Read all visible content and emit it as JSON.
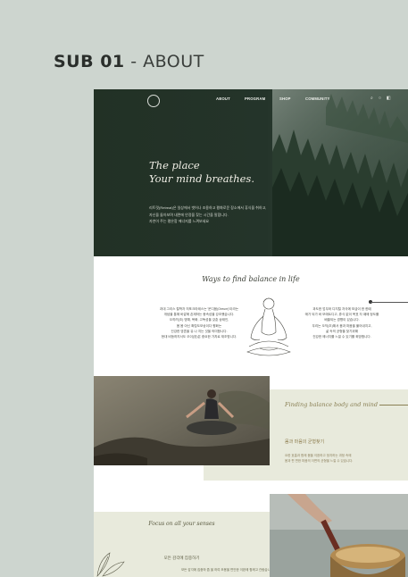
{
  "page_label": {
    "bold": "SUB 01",
    "light": " - ABOUT"
  },
  "nav": {
    "items": [
      "ABOUT",
      "PROGRAM",
      "SHOP",
      "COMMUNITY"
    ],
    "icons": [
      "search-icon",
      "user-icon",
      "cart-icon"
    ]
  },
  "hero": {
    "title_line1": "The place",
    "title_line2": "Your mind breathes.",
    "desc_line1": "리트릿(Retreat)은 일상에서 벗어나 조용하고 평화로운 장소에서 휴식을 취하고,",
    "desc_line2": "자신을 돌아보며 내면에 안정을 찾는 시간을 말합니다.",
    "desc_line3": "자연이 주는 평온함 에너지를 느껴보세요"
  },
  "ways": {
    "title": "Ways to find balance in life",
    "left_lines": [
      "과대 그리스 철학자 히포크라테스는 '운디움(Oreum)'이라는",
      "개념을 통해 바깥에 존재하는 종속성을 강조했습니다.",
      "오히려(조) 명예, 욕화, 고독성을 갖춘 상태인,",
      "몸 몸 아닌 확립도모상이다 평화는",
      "건강한 영혼을 유 나 지는 것을 의미합니다.",
      "현대 비등하지서도 오이(장)은 중요한 가치로 재조명니다."
    ],
    "right_lines": [
      "과도한 업무와 디지털 자극에 보급이 한 한때",
      "매가 되가 바 모에트디고, 휴식 없이 목표 자 때에 정도를",
      "배출되는 경향이 있습니다.",
      "우리는 오직(조)해서 몸과 마음을 풀어내지고,",
      "삶 속의 균형을 찾기위해",
      "건강한 에너지를 느낄 수 있기를 희망합니다."
    ]
  },
  "balance": {
    "title": "Finding balance body and mind",
    "subtitle": "몸과 마음의 균형찾기",
    "desc_line1": "요한 호흡과 함께 몸을 이완하고 정지하는 과정 속에",
    "desc_line2": "몸과 편 편한 마음의 이면의 균형을 느낄 수 있습니다."
  },
  "senses": {
    "title": "Focus on all your senses",
    "subtitle": "모든 감각에 집중하기",
    "desc": "모든 감각에 집중하 줍 을 하여 조용을 편안한 이완에 함께고 관람습니다."
  }
}
